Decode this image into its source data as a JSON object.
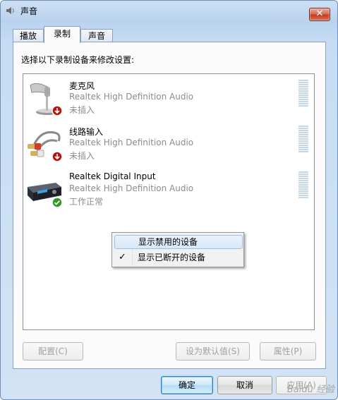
{
  "window": {
    "title": "声音",
    "close_label": "✕"
  },
  "tabs": [
    {
      "label": "播放",
      "active": false
    },
    {
      "label": "录制",
      "active": true
    },
    {
      "label": "声音",
      "active": false
    }
  ],
  "instruction": "选择以下录制设备来修改设置:",
  "devices": [
    {
      "name": "麦克风",
      "driver": "Realtek High Definition Audio",
      "status": "未插入",
      "icon": "microphone-icon",
      "badge": "unplugged-badge-icon"
    },
    {
      "name": "线路输入",
      "driver": "Realtek High Definition Audio",
      "status": "未插入",
      "icon": "line-in-cable-icon",
      "badge": "unplugged-badge-icon"
    },
    {
      "name": "Realtek Digital Input",
      "driver": "Realtek High Definition Audio",
      "status": "工作正常",
      "icon": "digital-input-device-icon",
      "badge": "ok-check-badge-icon"
    }
  ],
  "context_menu": {
    "items": [
      {
        "label": "显示禁用的设备",
        "checked": false,
        "highlighted": true
      },
      {
        "label": "显示已断开的设备",
        "checked": true,
        "highlighted": false
      }
    ],
    "check_glyph": "✓"
  },
  "panel_buttons": {
    "configure": "配置(C)",
    "set_default": "设为默认值(S)",
    "properties": "属性(P)"
  },
  "dialog_buttons": {
    "ok": "确定",
    "cancel": "取消",
    "apply": "应用(A)"
  },
  "watermark": "Baidu 经验",
  "colors": {
    "title_bg": "#c7dcf3",
    "close_red": "#c0391d",
    "default_button_blue": "#3a7fb8",
    "status_gray": "#8c8c8c",
    "badge_red": "#b5140c",
    "badge_green": "#2f9a22"
  }
}
